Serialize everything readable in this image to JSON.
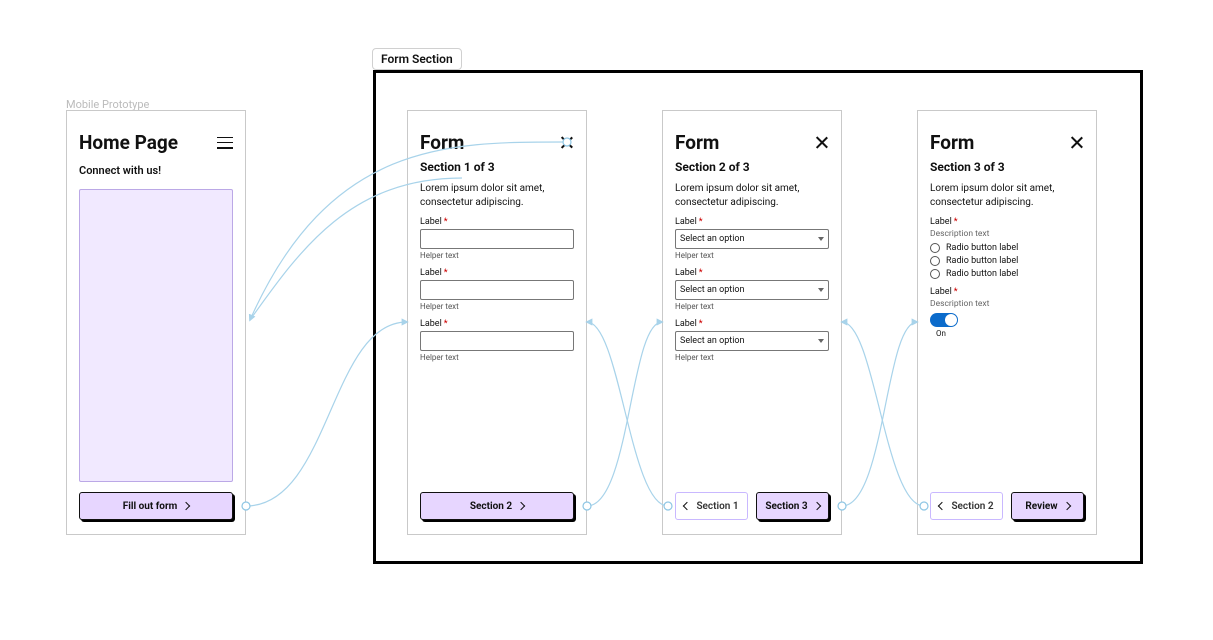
{
  "groupLabel": "Mobile Prototype",
  "sectionBadge": "Form Section",
  "home": {
    "title": "Home Page",
    "subhead": "Connect with us!",
    "cta": "Fill out form"
  },
  "form": {
    "title": "Form",
    "desc": "Lorem ipsum dolor sit amet, consectetur adipiscing.",
    "label": "Label",
    "helper": "Helper text",
    "selectPlaceholder": "Select an option",
    "descText": "Description text",
    "radio": "Radio button label",
    "toggleCap": "On"
  },
  "screens": [
    {
      "section": "Section 1 of 3",
      "navPrev": "",
      "navNext": "Section 2"
    },
    {
      "section": "Section 2 of 3",
      "navPrev": "Section 1",
      "navNext": "Section 3"
    },
    {
      "section": "Section 3 of 3",
      "navPrev": "Section 2",
      "navNext": "Review"
    }
  ]
}
